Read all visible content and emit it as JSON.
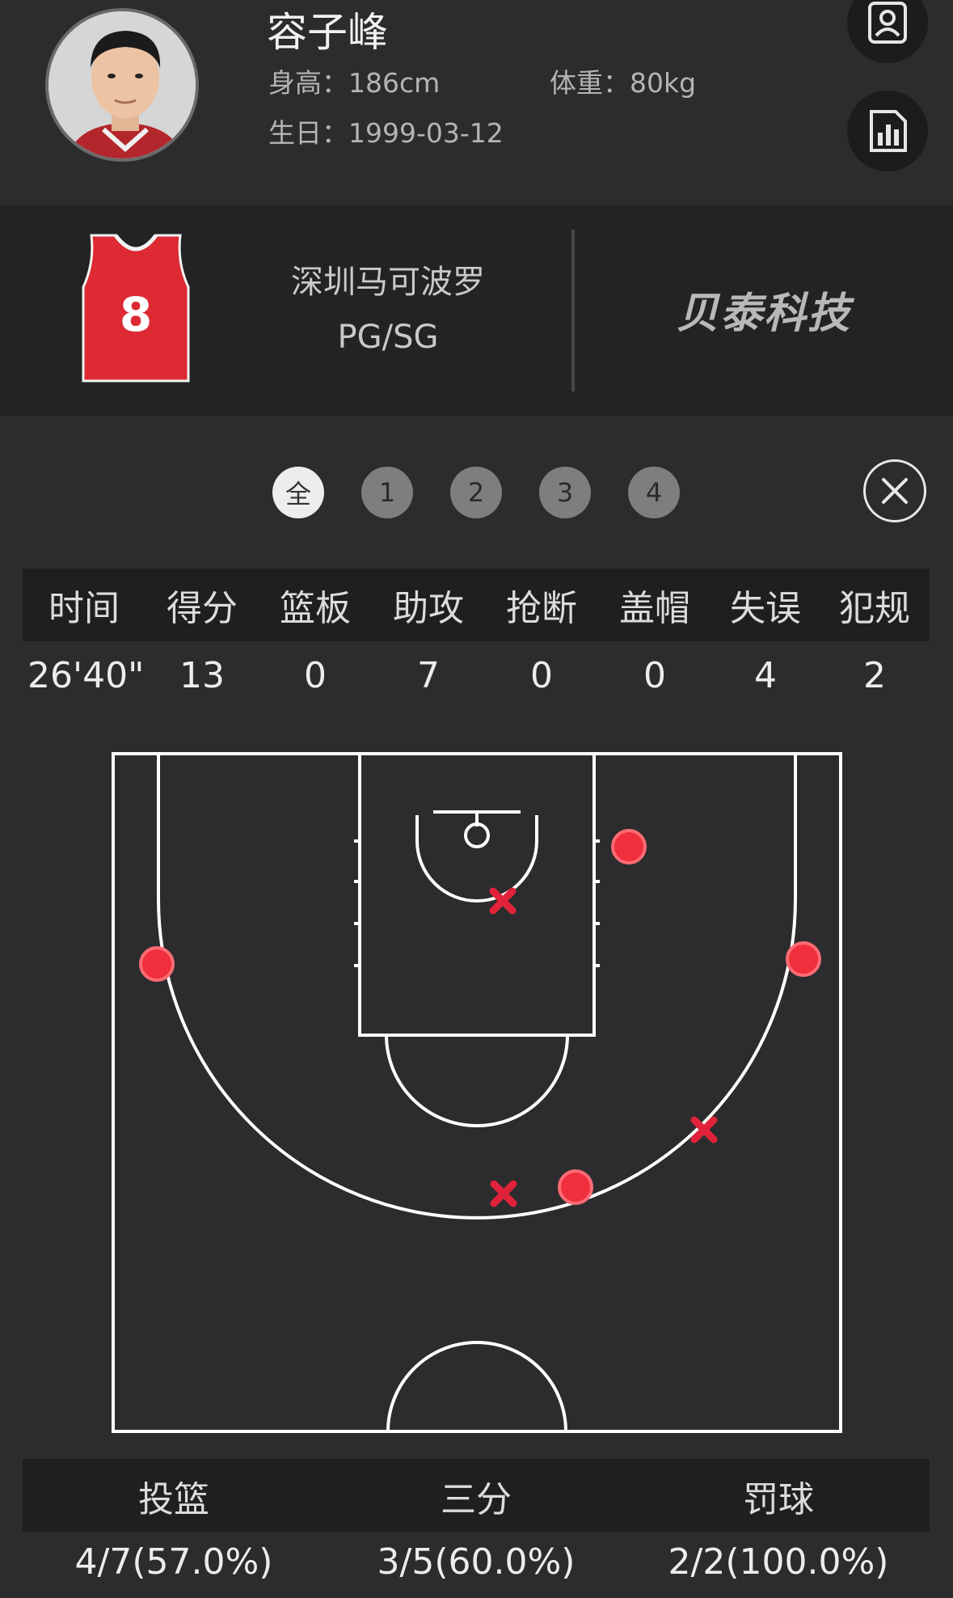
{
  "player": {
    "name": "容子峰",
    "height": "身高：186cm",
    "weight": "体重：80kg",
    "birth": "生日：1999-03-12"
  },
  "team": {
    "jersey_number": "8",
    "name": "深圳马可波罗",
    "position": "PG/SG",
    "sponsor": "贝泰科技"
  },
  "quarter_tabs": [
    "全",
    "1",
    "2",
    "3",
    "4"
  ],
  "stats": {
    "headers": [
      "时间",
      "得分",
      "篮板",
      "助攻",
      "抢断",
      "盖帽",
      "失误",
      "犯规"
    ],
    "values": [
      "26'40\"",
      "13",
      "0",
      "7",
      "0",
      "0",
      "4",
      "2"
    ]
  },
  "shooting": {
    "headers": [
      "投篮",
      "三分",
      "罚球"
    ],
    "values": [
      "4/7(57.0%)",
      "3/5(60.0%)",
      "2/2(100.0%)"
    ]
  },
  "colors": {
    "background": "#2c2c2e",
    "band": "#232325",
    "made_shot": "#f02e3c",
    "missed_shot": "#e0233a",
    "court_line": "#ffffff"
  },
  "icons": {
    "profile": "profile-icon",
    "stats": "stats-icon",
    "close": "close-icon"
  }
}
